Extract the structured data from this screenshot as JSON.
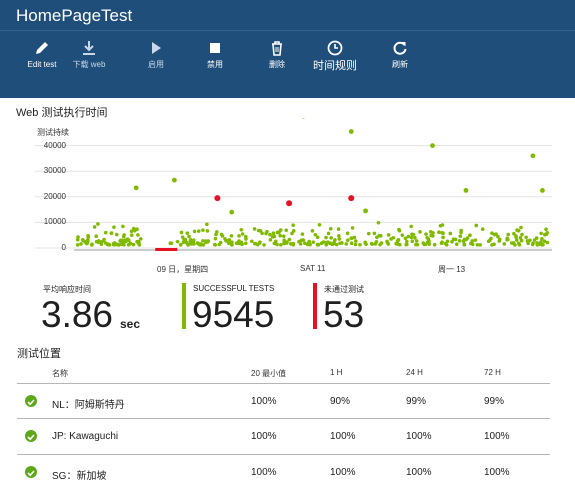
{
  "header": {
    "title": "HomePageTest"
  },
  "toolbar": [
    {
      "label": "Edit test",
      "icon": "pencil-icon",
      "name": "edit-test-button"
    },
    {
      "label": "下载 web",
      "icon": "download-icon",
      "name": "download-web-button"
    },
    {
      "label": "启用",
      "icon": "play-icon",
      "name": "enable-button"
    },
    {
      "label": "禁用",
      "icon": "stop-icon",
      "name": "disable-button"
    },
    {
      "label": "删除",
      "icon": "trash-icon",
      "name": "delete-button"
    },
    {
      "label": "时间规则",
      "icon": "clock-icon",
      "name": "time-rules-button"
    },
    {
      "label": "刷新",
      "icon": "refresh-icon",
      "name": "refresh-button"
    }
  ],
  "chart_section": {
    "title": "Web 测试执行时间"
  },
  "chart_data": {
    "type": "scatter",
    "title": "Web 测试执行时间",
    "ylabel": "测试持续",
    "ylim": [
      0,
      50000
    ],
    "yticks": [
      0,
      10000,
      20000,
      30000,
      40000
    ],
    "xticks": [
      "09 日，星期四",
      "SAT 11",
      "周一 13"
    ],
    "grid": true,
    "series": [
      {
        "name": "success",
        "color": "#7fba00",
        "points": [
          [
            0.13,
            23500
          ],
          [
            0.21,
            26500
          ],
          [
            0.48,
            51500
          ],
          [
            0.58,
            45500
          ],
          [
            0.75,
            40000
          ],
          [
            0.82,
            22500
          ],
          [
            0.96,
            36000
          ],
          [
            0.98,
            22500
          ],
          [
            0.33,
            14000
          ],
          [
            0.61,
            14500
          ]
        ]
      },
      {
        "name": "failed",
        "color": "#e81123",
        "points": [
          [
            0.3,
            19500
          ],
          [
            0.45,
            17500
          ],
          [
            0.58,
            19500
          ]
        ]
      }
    ]
  },
  "stats": {
    "avg_label": "平均响应时间",
    "avg_value": "3.86",
    "avg_unit": "sec",
    "success_label": "SUCCESSFUL TESTS",
    "success_value": "9545",
    "fail_label": "未通过测试",
    "fail_value": "53",
    "success_color": "#7fba00",
    "fail_color": "#e81123"
  },
  "locations": {
    "title": "测试位置",
    "headers": [
      "名称",
      "20 最小值",
      "1 H",
      "24 H",
      "72 H"
    ],
    "rows": [
      {
        "name": "NL：阿姆斯特丹",
        "min20": "100%",
        "h1": "90%",
        "h24": "99%",
        "h72": "99%"
      },
      {
        "name": "JP: Kawaguchi",
        "min20": "100%",
        "h1": "100%",
        "h24": "100%",
        "h72": "100%"
      },
      {
        "name": "SG：新加坡",
        "min20": "100%",
        "h1": "100%",
        "h24": "100%",
        "h72": "100%"
      }
    ]
  }
}
